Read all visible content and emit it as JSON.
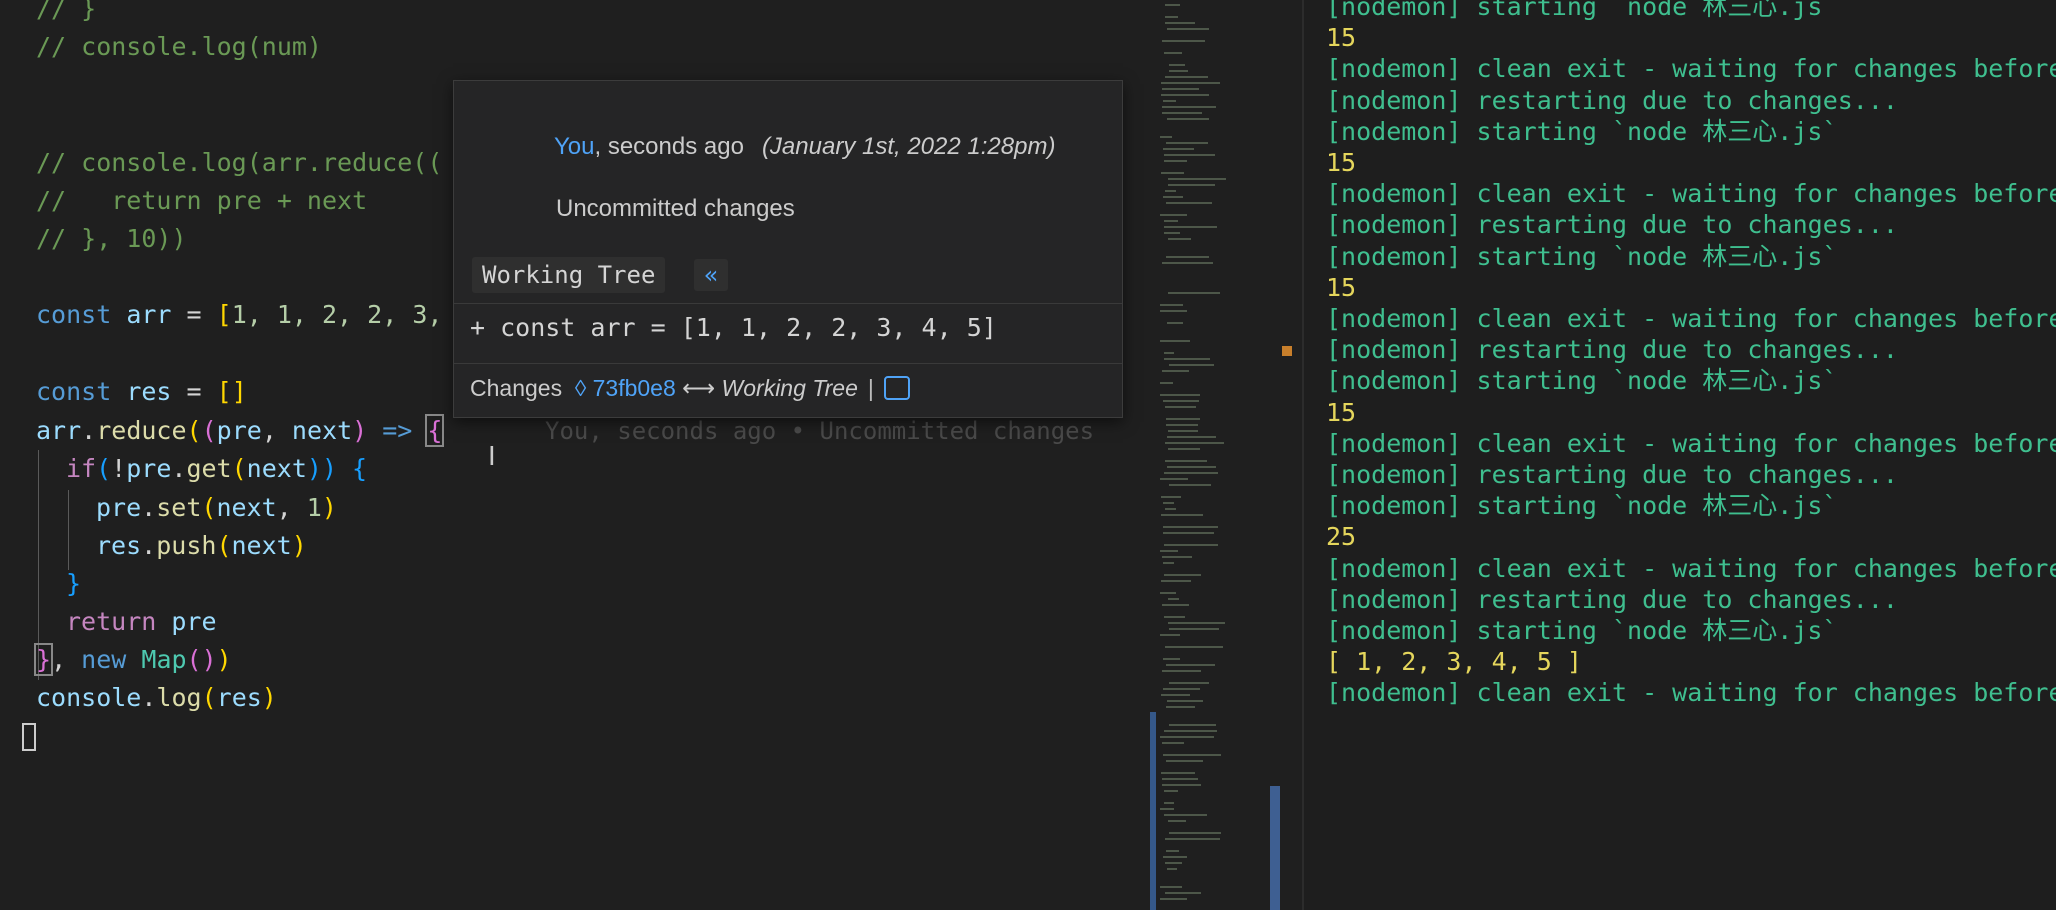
{
  "editor": {
    "lines": {
      "l1": "// }",
      "l2": "// console.log(num)",
      "l3a": "// console.log(arr.reduce((",
      "l4": "//   return pre + next",
      "l5": "// }, 10))",
      "arr_decl": {
        "kw": "const",
        "name": "arr",
        "eq": " = ",
        "open": "[",
        "vals": "1, 1, 2, 2, 3,"
      },
      "res_decl": {
        "kw": "const",
        "name": "res",
        "eq": " = ",
        "val": "[]"
      },
      "reduce_call": {
        "obj": "arr",
        "dot": ".",
        "fn": "reduce",
        "open": "(",
        "params_open": "(",
        "p1": "pre",
        "comma": ", ",
        "p2": "next",
        "params_close": ")",
        "arrow": " => ",
        "brace": "{"
      },
      "if_line": {
        "kw": "if",
        "open": "(",
        "not": "!",
        "obj": "pre",
        "fn": "get",
        "p_open": "(",
        "arg": "next",
        "p_close": "))",
        "brace": " {"
      },
      "set_line": {
        "obj": "pre",
        "fn": "set",
        "open": "(",
        "arg1": "next",
        "sep": ", ",
        "arg2": "1",
        "close": ")"
      },
      "push_line": {
        "obj": "res",
        "fn": "push",
        "open": "(",
        "arg": "next",
        "close": ")"
      },
      "close_if": "}",
      "return_line": {
        "kw": "return",
        "val": "pre"
      },
      "close_reduce": {
        "brace": "}",
        "comma": ", ",
        "kw": "new",
        "cls": "Map",
        "args": "()",
        "close": ")"
      },
      "log_line": {
        "obj": "console",
        "fn": "log",
        "open": "(",
        "arg": "res",
        "close": ")"
      }
    },
    "blame_ghost": "You, seconds ago • Uncommitted changes",
    "cursor_glyph": "I"
  },
  "hover": {
    "author": "You",
    "time": ", seconds ago",
    "date": "(January 1st, 2022 1:28pm)",
    "message": "Uncommitted changes",
    "working_tree": "Working Tree",
    "collapse_glyph": "«",
    "diff": "+ const arr = [1, 1, 2, 2, 3, 4, 5]",
    "changes_label": "Changes",
    "sha": "◊ 73fb0e8",
    "arrow": "⟷",
    "changes_target": "Working Tree",
    "pipe": "|"
  },
  "terminal": {
    "lines": [
      {
        "text": "[nodemon] starting `node 林三心.js`",
        "kind": "log"
      },
      {
        "text": "15",
        "kind": "out"
      },
      {
        "text": "[nodemon] clean exit - waiting for changes before",
        "kind": "log"
      },
      {
        "text": "[nodemon] restarting due to changes...",
        "kind": "log"
      },
      {
        "text": "[nodemon] starting `node 林三心.js`",
        "kind": "log"
      },
      {
        "text": "15",
        "kind": "out"
      },
      {
        "text": "[nodemon] clean exit - waiting for changes before",
        "kind": "log"
      },
      {
        "text": "[nodemon] restarting due to changes...",
        "kind": "log"
      },
      {
        "text": "[nodemon] starting `node 林三心.js`",
        "kind": "log"
      },
      {
        "text": "15",
        "kind": "out"
      },
      {
        "text": "[nodemon] clean exit - waiting for changes before",
        "kind": "log"
      },
      {
        "text": "[nodemon] restarting due to changes...",
        "kind": "log"
      },
      {
        "text": "[nodemon] starting `node 林三心.js`",
        "kind": "log"
      },
      {
        "text": "15",
        "kind": "out"
      },
      {
        "text": "[nodemon] clean exit - waiting for changes before",
        "kind": "log"
      },
      {
        "text": "[nodemon] restarting due to changes...",
        "kind": "log"
      },
      {
        "text": "[nodemon] starting `node 林三心.js`",
        "kind": "log"
      },
      {
        "text": "25",
        "kind": "out"
      },
      {
        "text": "[nodemon] clean exit - waiting for changes before",
        "kind": "log"
      },
      {
        "text": "[nodemon] restarting due to changes...",
        "kind": "log"
      },
      {
        "text": "[nodemon] starting `node 林三心.js`",
        "kind": "log"
      },
      {
        "text": "[ 1, 2, 3, 4, 5 ]",
        "kind": "out"
      },
      {
        "text": "[nodemon] clean exit - waiting for changes before",
        "kind": "log"
      }
    ]
  },
  "colors": {
    "comment": "#6a9955",
    "keyword": "#569cd6",
    "terminal_log": "#3fbf8f",
    "terminal_output": "#e5d65c",
    "link": "#4fa3f7"
  }
}
